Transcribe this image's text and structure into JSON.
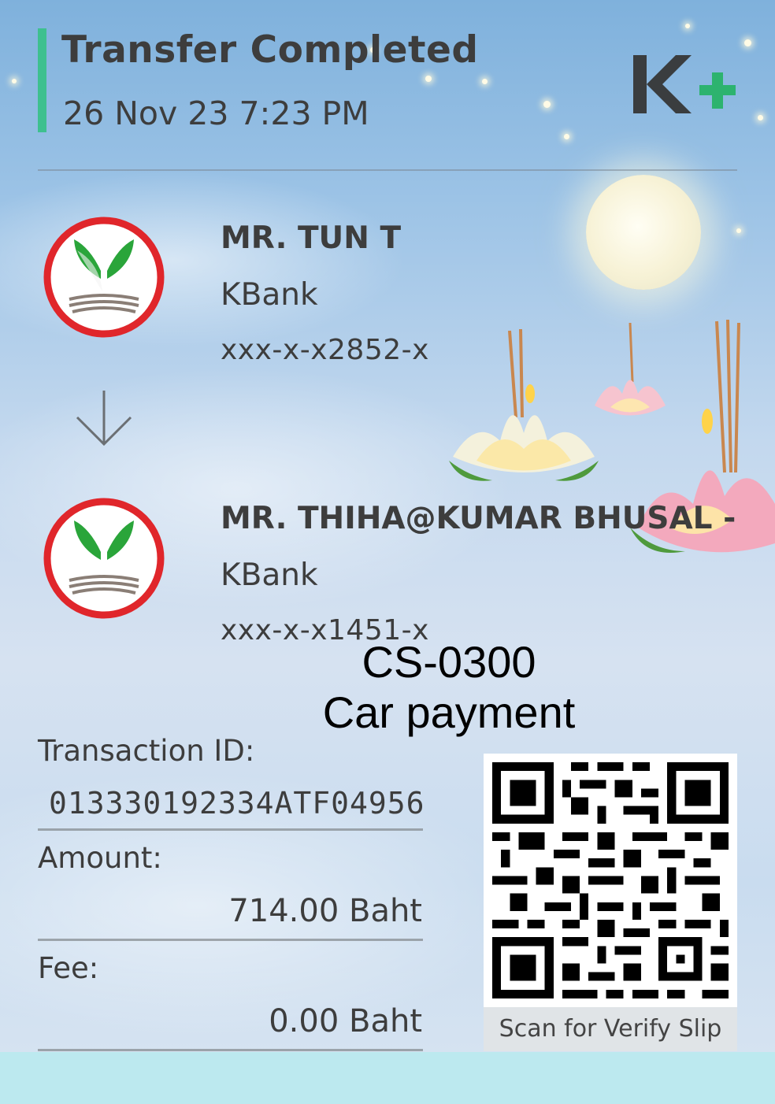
{
  "header": {
    "title": "Transfer Completed",
    "datetime": "26 Nov 23  7:23 PM",
    "brand_logo": "K+",
    "accent_color": "#3ec08f"
  },
  "sender": {
    "name": "MR. TUN T",
    "bank": "KBank",
    "account": "xxx-x-x2852-x",
    "icon": "kbank-logo-icon"
  },
  "receiver": {
    "name": "MR. THIHA@KUMAR BHUSAL -",
    "bank": "KBank",
    "account": "xxx-x-x1451-x",
    "icon": "kbank-logo-icon"
  },
  "memo": {
    "line1": "CS-0300",
    "line2": "Car payment"
  },
  "details": {
    "transaction_label": "Transaction ID:",
    "transaction_id": "013330192334ATF04956",
    "amount_label": "Amount:",
    "amount_value": "714.00 Baht",
    "fee_label": "Fee:",
    "fee_value": "0.00 Baht"
  },
  "qr": {
    "caption": "Scan for Verify Slip",
    "icon": "qr-code-icon"
  }
}
